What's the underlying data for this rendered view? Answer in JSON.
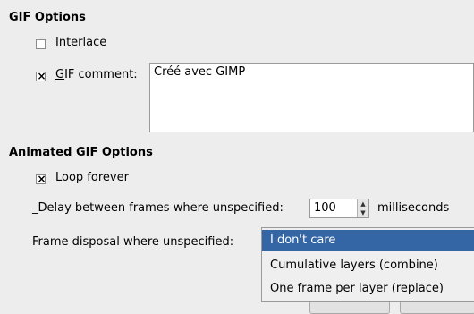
{
  "gif_options": {
    "heading": "GIF Options",
    "interlace": {
      "prefix": "",
      "mnemonic": "I",
      "rest": "nterlace",
      "checked": false
    },
    "comment": {
      "prefix": "",
      "mnemonic": "G",
      "rest": "IF comment:",
      "checked": true,
      "value": "Créé avec GIMP"
    }
  },
  "animated": {
    "heading": "Animated GIF Options",
    "loop": {
      "mnemonic": "L",
      "rest": "oop forever",
      "checked": true
    },
    "delay": {
      "label": "_Delay between frames where unspecified:",
      "value": "100",
      "unit": "milliseconds"
    },
    "disposal": {
      "label": "Frame disposal where unspecified:",
      "options": [
        "I don't care",
        "Cumulative layers (combine)",
        "One frame per layer (replace)"
      ],
      "selected_index": 0
    }
  },
  "colors": {
    "selection": "#3465a4",
    "background": "#ededed"
  }
}
